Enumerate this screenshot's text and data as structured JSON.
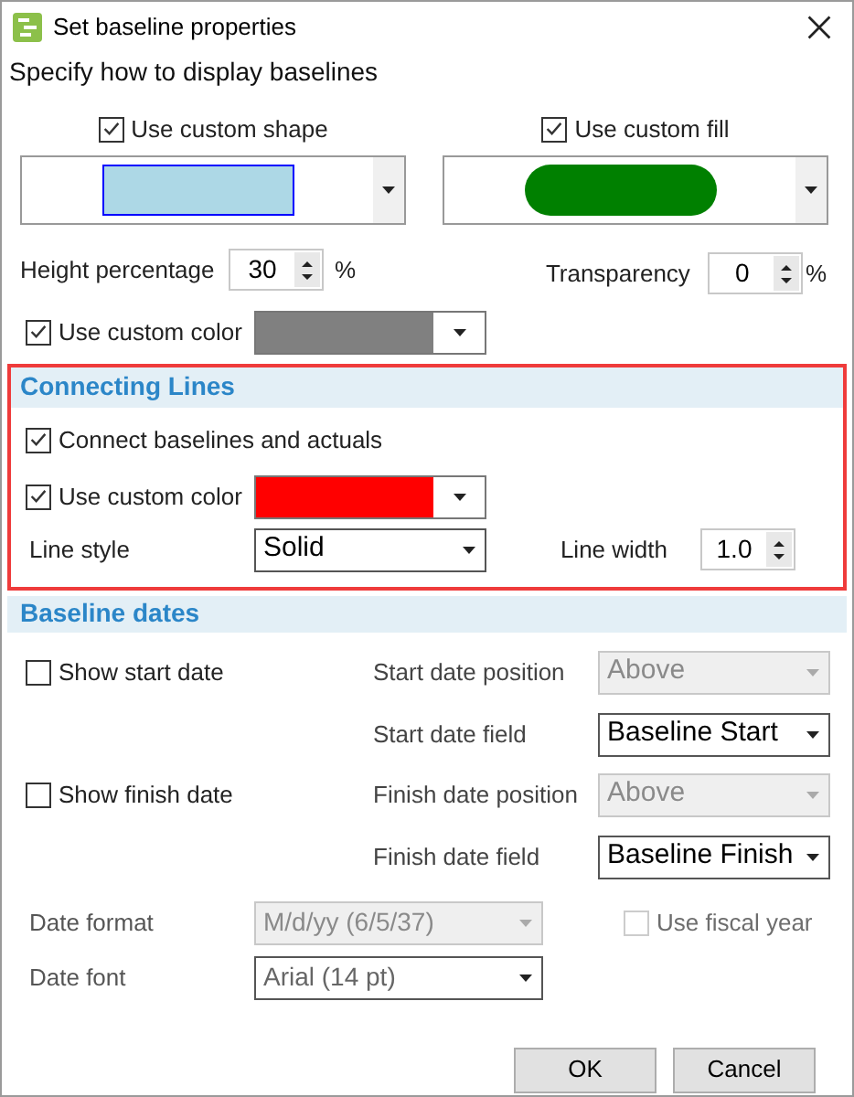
{
  "window": {
    "title": "Set baseline properties"
  },
  "subtitle": "Specify how to display baselines",
  "pickers": [
    {
      "label": "Use custom shape",
      "checked": true,
      "kind": "rectangle",
      "color": "#add8e6"
    },
    {
      "label": "Use custom fill",
      "checked": true,
      "kind": "pill",
      "color": "#008000"
    }
  ],
  "height": {
    "label": "Height percentage",
    "value": "30",
    "unit": "%"
  },
  "transparency": {
    "label": "Transparency",
    "value": "0",
    "unit": "%"
  },
  "bar_color": {
    "label": "Use custom color",
    "checked": true,
    "color": "#808080"
  },
  "connecting_lines": {
    "title": "Connecting Lines",
    "highlighted": true,
    "connect": {
      "label": "Connect baselines and actuals",
      "checked": true
    },
    "custom_color": {
      "label": "Use custom color",
      "checked": true,
      "color": "#ff0000"
    },
    "line_style": {
      "label": "Line style",
      "value": "Solid"
    },
    "line_width": {
      "label": "Line width",
      "value": "1.0"
    }
  },
  "baseline_dates": {
    "title": "Baseline dates",
    "show_start": {
      "label": "Show start date",
      "checked": false
    },
    "start_position": {
      "label": "Start date position",
      "value": "Above",
      "disabled": true
    },
    "start_field": {
      "label": "Start date field",
      "value": "Baseline Start",
      "disabled": false
    },
    "show_finish": {
      "label": "Show finish date",
      "checked": false
    },
    "finish_position": {
      "label": "Finish date position",
      "value": "Above",
      "disabled": true
    },
    "finish_field": {
      "label": "Finish date field",
      "value": "Baseline Finish",
      "disabled": false
    },
    "date_format": {
      "label": "Date format",
      "value": "M/d/yy (6/5/37)",
      "disabled": true
    },
    "fiscal_year": {
      "label": "Use fiscal year",
      "checked": false,
      "disabled": true
    },
    "date_font": {
      "label": "Date font",
      "value": "Arial (14 pt)"
    }
  },
  "buttons": [
    "OK",
    "Cancel"
  ]
}
